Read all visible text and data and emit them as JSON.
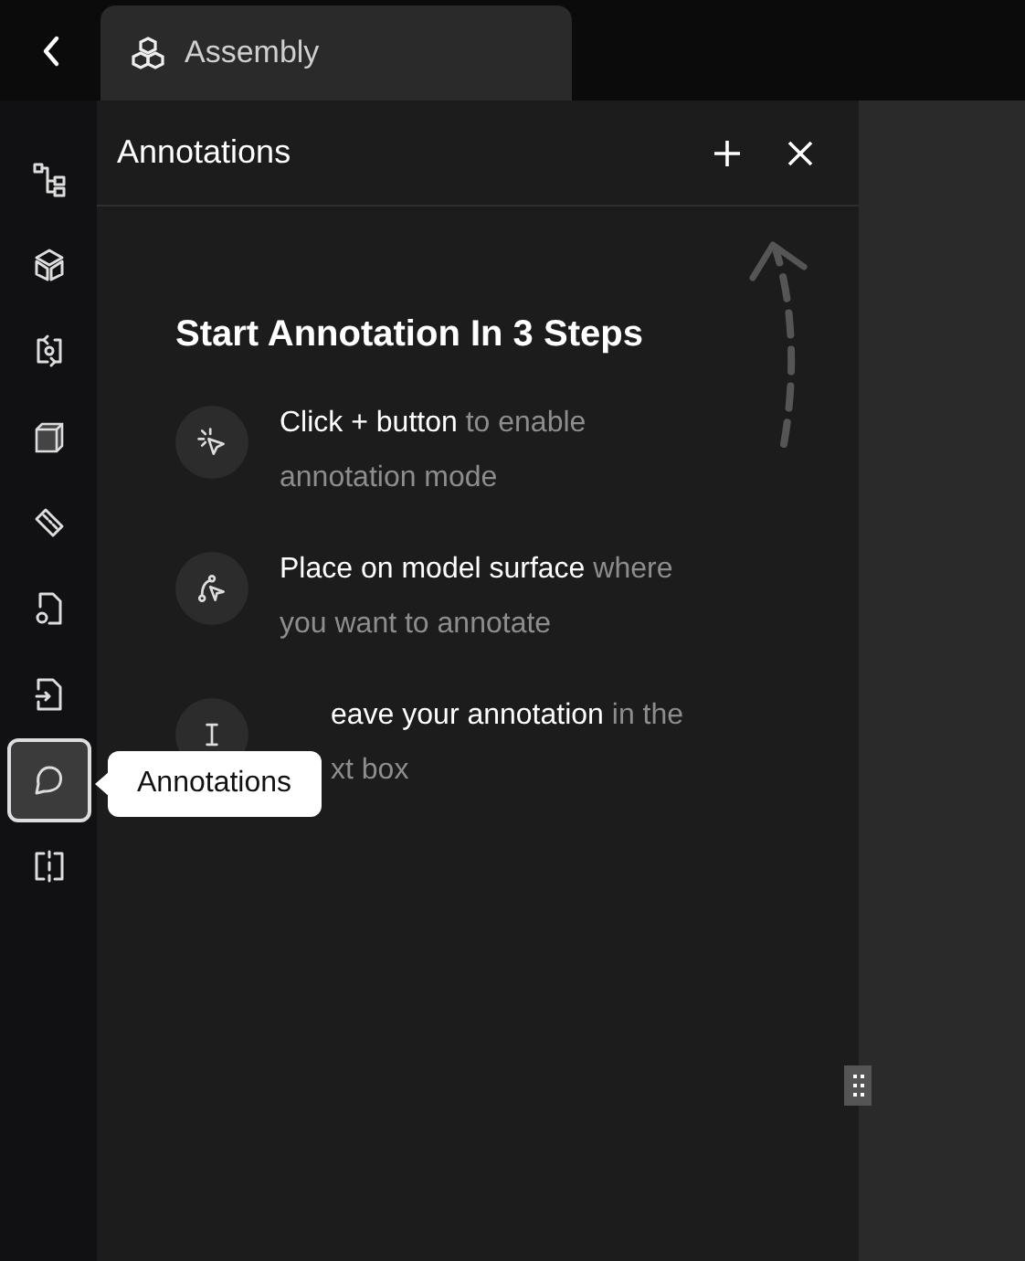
{
  "tab": {
    "title": "Assembly"
  },
  "sidebar": {
    "items": [
      {
        "kind": "tree",
        "selected": false
      },
      {
        "kind": "cube-outline",
        "selected": false
      },
      {
        "kind": "rotate",
        "selected": false
      },
      {
        "kind": "solid",
        "selected": false
      },
      {
        "kind": "ruler",
        "selected": false
      },
      {
        "kind": "file-gear",
        "selected": false
      },
      {
        "kind": "file-import",
        "selected": false
      },
      {
        "kind": "comment",
        "selected": true
      },
      {
        "kind": "split",
        "selected": false
      }
    ]
  },
  "panel": {
    "title": "Annotations",
    "heading": "Start Annotation In 3 Steps",
    "steps": [
      {
        "kind": "click",
        "covered": false,
        "lines": [
          {
            "bold": "Click + button",
            "rest": "to enable"
          },
          {
            "rest": "annotation mode"
          }
        ]
      },
      {
        "kind": "place",
        "covered": false,
        "lines": [
          {
            "bold": "Place on model surface",
            "rest": "where"
          },
          {
            "rest": "you want to annotate"
          }
        ]
      },
      {
        "kind": "leave",
        "covered": true,
        "lines": [
          {
            "bold": "eave your annotation",
            "rest": "in the"
          },
          {
            "rest": "xt box"
          }
        ]
      }
    ]
  },
  "tooltip": "Annotations"
}
